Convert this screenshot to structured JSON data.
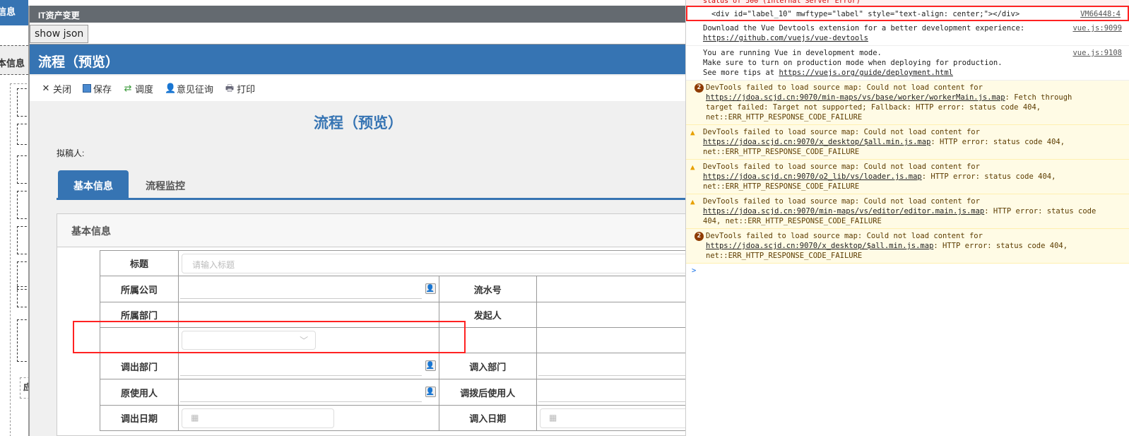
{
  "background": {
    "header": "信息",
    "section": "本信息",
    "partial": "应"
  },
  "modal": {
    "title": "IT资产变更",
    "show_json": "show json",
    "header": "流程（预览）",
    "toolbar": [
      {
        "label": "关闭",
        "icon": "close-icon"
      },
      {
        "label": "保存",
        "icon": "save-icon"
      },
      {
        "label": "调度",
        "icon": "dispatch-icon"
      },
      {
        "label": "意见征询",
        "icon": "user-add-icon"
      },
      {
        "label": "打印",
        "icon": "print-icon"
      }
    ],
    "page_title": "流程（预览）",
    "drafter_label": "拟稿人:",
    "tabs": [
      "基本信息",
      "流程监控"
    ],
    "panel_title": "基本信息",
    "form": {
      "title_label": "标题",
      "title_placeholder": "请输入标题",
      "company_label": "所属公司",
      "serial_label": "流水号",
      "dept_label": "所属部门",
      "initiator_label": "发起人",
      "out_dept_label": "调出部门",
      "in_dept_label": "调入部门",
      "orig_user_label": "原使用人",
      "new_user_label": "调拨后使用人",
      "out_date_label": "调出日期",
      "in_date_label": "调入日期"
    }
  },
  "console": {
    "top_partial": "status of 500 (Internal Server Error)",
    "messages": [
      {
        "text": "<div id=\"label_10\" mwftype=\"label\" style=\"text-align: center;\"></div>",
        "source": "VM66448:4"
      },
      {
        "text": "Download the Vue Devtools extension for a better development experience:",
        "link": "https://github.com/vuejs/vue-devtools",
        "source": "vue.js:9099"
      },
      {
        "text": "You are running Vue in development mode.\nMake sure to turn on production mode when deploying for production.\nSee more tips at ",
        "link": "https://vuejs.org/guide/deployment.html",
        "source": "vue.js:9108"
      },
      {
        "count": "2",
        "pre": "DevTools failed to load source map: Could not load content for ",
        "link": "https://jdoa.scjd.cn:9070/min-maps/vs/base/worker/workerMain.js.map",
        "post": ": Fetch through target failed: Target not supported; Fallback: HTTP error: status code 404, net::ERR_HTTP_RESPONSE_CODE_FAILURE"
      },
      {
        "pre": "DevTools failed to load source map: Could not load content for ",
        "link": "https://jdoa.scjd.cn:9070/x_desktop/$all.min.js.map",
        "post": ": HTTP error: status code 404, net::ERR_HTTP_RESPONSE_CODE_FAILURE"
      },
      {
        "pre": "DevTools failed to load source map: Could not load content for ",
        "link": "https://jdoa.scjd.cn:9070/o2_lib/vs/loader.js.map",
        "post": ": HTTP error: status code 404, net::ERR_HTTP_RESPONSE_CODE_FAILURE"
      },
      {
        "pre": "DevTools failed to load source map: Could not load content for ",
        "link": "https://jdoa.scjd.cn:9070/min-maps/vs/editor/editor.main.js.map",
        "post": ": HTTP error: status code 404, net::ERR_HTTP_RESPONSE_CODE_FAILURE"
      },
      {
        "count": "2",
        "pre": "DevTools failed to load source map: Could not load content for ",
        "link": "https://jdoa.scjd.cn:9070/x_desktop/$all.min.js.map",
        "post": ": HTTP error: status code 404, net::ERR_HTTP_RESPONSE_CODE_FAILURE"
      }
    ],
    "prompt": ">"
  }
}
